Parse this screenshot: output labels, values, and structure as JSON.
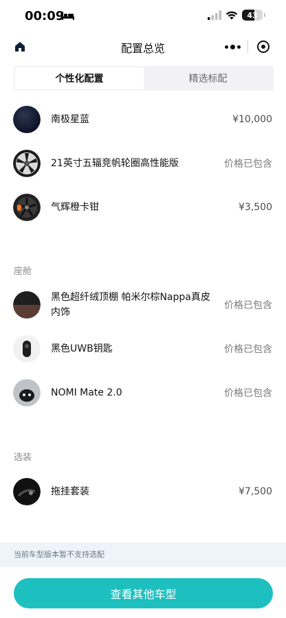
{
  "status_bar": {
    "time": "00:09",
    "battery": "43"
  },
  "nav": {
    "title": "配置总览"
  },
  "tabs": [
    {
      "label": "个性化配置",
      "active": true
    },
    {
      "label": "精选标配",
      "active": false
    }
  ],
  "exterior": [
    {
      "name": "南极星蓝",
      "price": "¥10,000",
      "icon": "dark-blue-swatch"
    },
    {
      "name": "21英寸五辐竞帆轮圈高性能版",
      "price": "价格已包含",
      "icon": "wheel-rim"
    },
    {
      "name": "气辉橙卡钳",
      "price": "¥3,500",
      "icon": "orange-caliper-wheel"
    }
  ],
  "cabin": {
    "heading": "座舱",
    "items": [
      {
        "name": "黑色超纤绒顶棚 帕米尔棕Nappa真皮内饰",
        "price": "价格已包含",
        "icon": "interior-swatch"
      },
      {
        "name": "黑色UWB钥匙",
        "price": "价格已包含",
        "icon": "uwb-key"
      },
      {
        "name": "NOMI Mate 2.0",
        "price": "价格已包含",
        "icon": "nomi-robot"
      }
    ]
  },
  "options": {
    "heading": "选装",
    "items": [
      {
        "name": "拖挂套装",
        "price": "¥7,500",
        "icon": "tow-hitch"
      }
    ]
  },
  "notice": "当前车型版本暂不支持选配",
  "cta": "查看其他车型"
}
